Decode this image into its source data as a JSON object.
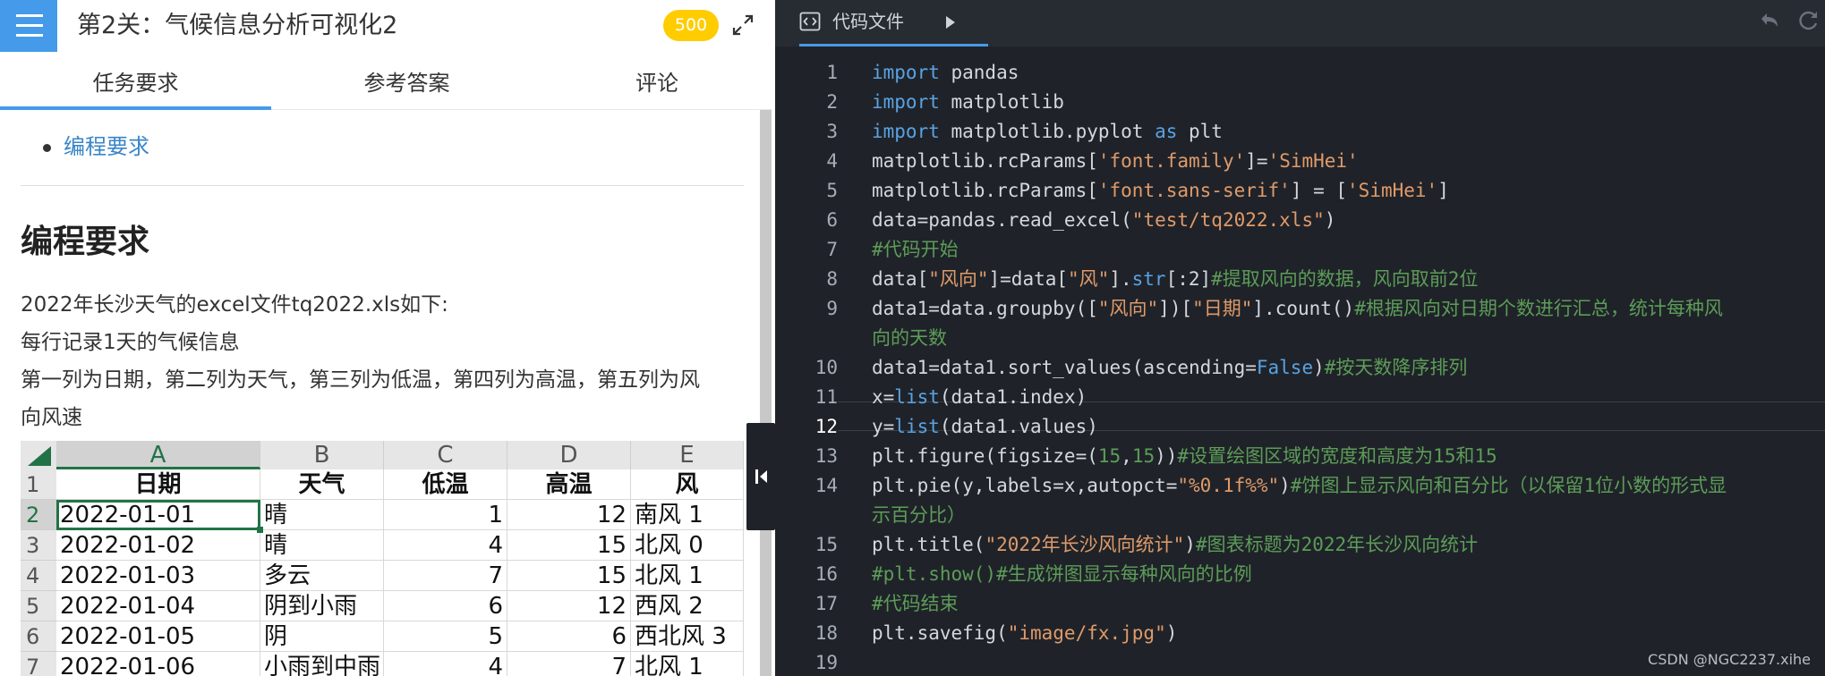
{
  "header": {
    "title": "第2关：气候信息分析可视化2",
    "points": "500"
  },
  "tabs": [
    "任务要求",
    "参考答案",
    "评论"
  ],
  "task": {
    "toc_link": "编程要求",
    "heading": "编程要求",
    "paragraphs": [
      "2022年长沙天气的excel文件tq2022.xls如下:",
      "每行记录1天的气候信息",
      "第一列为日期，第二列为天气，第三列为低温，第四列为高温，第五列为风",
      "向风速"
    ]
  },
  "sheet": {
    "columns": [
      "A",
      "B",
      "C",
      "D",
      "E"
    ],
    "header_row": [
      "日期",
      "天气",
      "低温",
      "高温",
      "风"
    ],
    "rows": [
      {
        "num": "1"
      },
      {
        "num": "2",
        "cells": [
          "2022-01-01",
          "晴",
          "1",
          "12",
          "南风 1"
        ]
      },
      {
        "num": "3",
        "cells": [
          "2022-01-02",
          "晴",
          "4",
          "15",
          "北风 0"
        ]
      },
      {
        "num": "4",
        "cells": [
          "2022-01-03",
          "多云",
          "7",
          "15",
          "北风 1"
        ]
      },
      {
        "num": "5",
        "cells": [
          "2022-01-04",
          "阴到小雨",
          "6",
          "12",
          "西风 2"
        ]
      },
      {
        "num": "6",
        "cells": [
          "2022-01-05",
          "阴",
          "5",
          "6",
          "西北风 3"
        ]
      },
      {
        "num": "7",
        "cells": [
          "2022-01-06",
          "小雨到中雨",
          "4",
          "7",
          "北风 1"
        ]
      }
    ]
  },
  "editor": {
    "tab_label": "代码文件",
    "active_line": "12",
    "line_numbers": [
      "1",
      "2",
      "3",
      "4",
      "5",
      "6",
      "7",
      "8",
      "9",
      "10",
      "11",
      "12",
      "13",
      "14",
      "15",
      "16",
      "17",
      "18",
      "19"
    ],
    "lines": [
      [
        {
          "t": "import",
          "c": "kw"
        },
        {
          "t": " pandas",
          "c": "pl"
        }
      ],
      [
        {
          "t": "import",
          "c": "kw"
        },
        {
          "t": " matplotlib",
          "c": "pl"
        }
      ],
      [
        {
          "t": "import",
          "c": "kw"
        },
        {
          "t": " matplotlib.pyplot ",
          "c": "pl"
        },
        {
          "t": "as",
          "c": "kw"
        },
        {
          "t": " plt",
          "c": "pl"
        }
      ],
      [
        {
          "t": "matplotlib.rcParams[",
          "c": "pl"
        },
        {
          "t": "'font.family'",
          "c": "st"
        },
        {
          "t": "]=",
          "c": "pl"
        },
        {
          "t": "'SimHei'",
          "c": "st"
        }
      ],
      [
        {
          "t": "matplotlib.rcParams[",
          "c": "pl"
        },
        {
          "t": "'font.sans-serif'",
          "c": "st"
        },
        {
          "t": "] = [",
          "c": "pl"
        },
        {
          "t": "'SimHei'",
          "c": "st"
        },
        {
          "t": "]",
          "c": "pl"
        }
      ],
      [
        {
          "t": "data=pandas.read_excel(",
          "c": "pl"
        },
        {
          "t": "\"test/tq2022.xls\"",
          "c": "st"
        },
        {
          "t": ")",
          "c": "pl"
        }
      ],
      [
        {
          "t": "#代码开始",
          "c": "cm"
        }
      ],
      [
        {
          "t": "data[",
          "c": "pl"
        },
        {
          "t": "\"风向\"",
          "c": "st"
        },
        {
          "t": "]=data[",
          "c": "pl"
        },
        {
          "t": "\"风\"",
          "c": "st"
        },
        {
          "t": "].",
          "c": "pl"
        },
        {
          "t": "str",
          "c": "kw"
        },
        {
          "t": "[:2]",
          "c": "pl"
        },
        {
          "t": "#提取风向的数据，风向取前2位",
          "c": "cm"
        }
      ],
      [
        {
          "t": "data1=data.groupby([",
          "c": "pl"
        },
        {
          "t": "\"风向\"",
          "c": "st"
        },
        {
          "t": "])[",
          "c": "pl"
        },
        {
          "t": "\"日期\"",
          "c": "st"
        },
        {
          "t": "].count()",
          "c": "pl"
        },
        {
          "t": "#根据风向对日期个数进行汇总，统计每种风",
          "c": "cm"
        }
      ],
      [
        {
          "t": "data1=data1.sort_values(ascending=",
          "c": "pl"
        },
        {
          "t": "False",
          "c": "kw"
        },
        {
          "t": ")",
          "c": "pl"
        },
        {
          "t": "#按天数降序排列",
          "c": "cm"
        }
      ],
      [
        {
          "t": "x=",
          "c": "pl"
        },
        {
          "t": "list",
          "c": "kw"
        },
        {
          "t": "(data1.index)",
          "c": "pl"
        }
      ],
      [
        {
          "t": "y=",
          "c": "pl"
        },
        {
          "t": "list",
          "c": "kw"
        },
        {
          "t": "(data1.values)",
          "c": "pl"
        }
      ],
      [
        {
          "t": "plt.figure(figsize=(",
          "c": "pl"
        },
        {
          "t": "15",
          "c": "cm"
        },
        {
          "t": ",",
          "c": "pl"
        },
        {
          "t": "15",
          "c": "cm"
        },
        {
          "t": "))",
          "c": "pl"
        },
        {
          "t": "#设置绘图区域的宽度和高度为15和15",
          "c": "cm"
        }
      ],
      [
        {
          "t": "plt.pie(y,labels=x,autopct=",
          "c": "pl"
        },
        {
          "t": "\"%0.1f%%\"",
          "c": "st"
        },
        {
          "t": ")",
          "c": "pl"
        },
        {
          "t": "#饼图上显示风向和百分比（以保留1位小数的形式显",
          "c": "cm"
        }
      ],
      [
        {
          "t": "plt.title(",
          "c": "pl"
        },
        {
          "t": "\"2022年长沙风向统计\"",
          "c": "st"
        },
        {
          "t": ")",
          "c": "pl"
        },
        {
          "t": "#图表标题为2022年长沙风向统计",
          "c": "cm"
        }
      ],
      [
        {
          "t": "#plt.show()#生成饼图显示每种风向的比例",
          "c": "cm"
        }
      ],
      [
        {
          "t": "#代码结束",
          "c": "cm"
        }
      ],
      [
        {
          "t": "plt.savefig(",
          "c": "pl"
        },
        {
          "t": "\"image/fx.jpg\"",
          "c": "st"
        },
        {
          "t": ")",
          "c": "pl"
        }
      ],
      []
    ],
    "wraps": {
      "9": "向的天数",
      "14": "示百分比）"
    }
  },
  "watermark": "CSDN @NGC2237.xihe",
  "colors": {
    "accent": "#459ae9",
    "badge": "#ffcc00",
    "editor_bg": "#1f2329",
    "keyword": "#5aa2e3",
    "string": "#e09a6a",
    "comment": "#5d9c58",
    "excel_green": "#217346"
  },
  "icons": {
    "menu": "hamburger-menu-icon",
    "expand": "expand-icon",
    "collapse": "collapse-panel-icon",
    "file": "code-file-icon",
    "run": "play-icon",
    "undo": "undo-icon",
    "redo": "redo-icon"
  }
}
